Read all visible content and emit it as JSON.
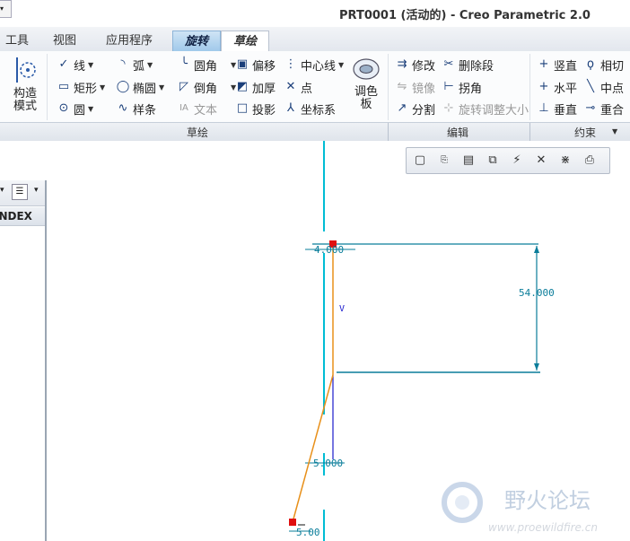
{
  "window": {
    "title": "PRT0001 (活动的) - Creo Parametric 2.0"
  },
  "tabs": [
    {
      "label": "工具"
    },
    {
      "label": "视图"
    },
    {
      "label": "应用程序"
    },
    {
      "label": "旋转"
    },
    {
      "label": "草绘"
    }
  ],
  "ribbon": {
    "construct_mode": {
      "line1": "构造",
      "line2": "模式"
    },
    "sketch": {
      "line": "线",
      "arc": "弧",
      "fillet": "圆角",
      "offset": "偏移",
      "centerline": "中心线",
      "rectangle": "矩形",
      "ellipse": "椭圆",
      "chamfer": "倒角",
      "thicken": "加厚",
      "point": "点",
      "circle": "圆",
      "spline": "样条",
      "text": "文本",
      "project": "投影",
      "coordsys": "坐标系"
    },
    "palette": {
      "line1": "调色",
      "line2": "板"
    },
    "edit": {
      "modify": "修改",
      "delete_segment": "删除段",
      "mirror": "镜像",
      "corner": "拐角",
      "divide": "分割",
      "rotate_resize": "旋转调整大小"
    },
    "constrain": {
      "vertical": "竖直",
      "tangent": "相切",
      "horizontal": "水平",
      "midpoint": "中点",
      "perpendicular": "垂直",
      "coincident": "重合"
    },
    "groups": {
      "sketch": "草绘",
      "edit": "编辑",
      "constrain": "约束"
    }
  },
  "left_panel": {
    "header": "INDEX"
  },
  "sketch": {
    "dim_top": "4.000",
    "dim_height": "54.000",
    "constraint_v": "V",
    "dim_middle": "5.000",
    "dim_bottom": "5.00"
  },
  "watermark": {
    "name": "野火论坛",
    "url": "www.proewildfire.cn"
  },
  "colors": {
    "centerline": "#00bcd4",
    "dimension": "#0a7d9a",
    "geometry": "#e8901a",
    "blue_line": "#1a1acc",
    "marker": "#e01010"
  }
}
